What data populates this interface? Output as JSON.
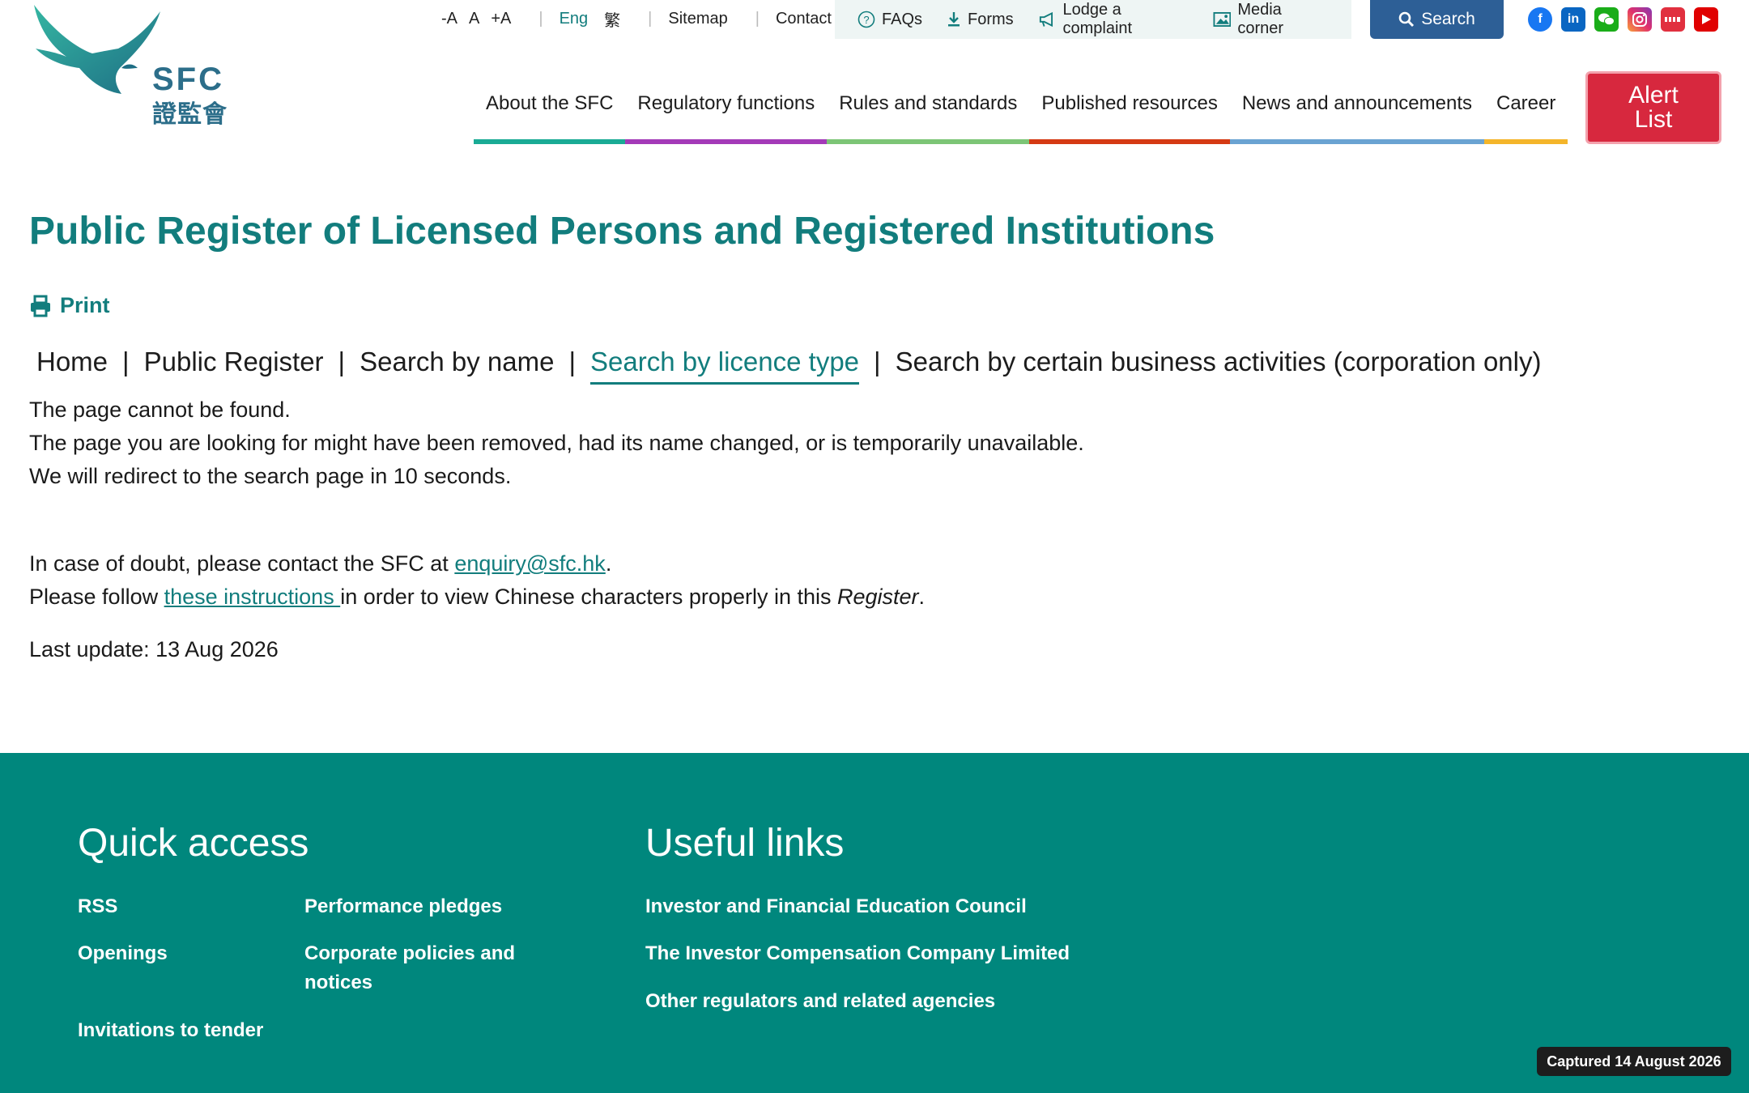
{
  "brand": {
    "name": "SFC",
    "name_cn": "證監會",
    "color": "#2c6e8a",
    "accent": "#127d7d"
  },
  "utility": {
    "font_small": "-A",
    "font_normal": "A",
    "font_large": "+A",
    "lang_en": "Eng",
    "lang_tc": "繁",
    "sitemap": "Sitemap",
    "contact": "Contact us",
    "faqs": "FAQs",
    "forms": "Forms",
    "complaint": "Lodge a complaint",
    "media": "Media corner",
    "search": "Search"
  },
  "socials": [
    "facebook-icon",
    "linkedin-icon",
    "wechat-icon",
    "instagram-icon",
    "xiaohongshu-icon",
    "youtube-icon"
  ],
  "nav": {
    "items": [
      {
        "label": "About the SFC",
        "color": "#1aab95"
      },
      {
        "label": "Regulatory functions",
        "color": "#a43ab8"
      },
      {
        "label": "Rules and standards",
        "color": "#7cc576"
      },
      {
        "label": "Published resources",
        "color": "#d53a14"
      },
      {
        "label": "News and announcements",
        "color": "#6aa3d2"
      },
      {
        "label": "Career",
        "color": "#f4b52a"
      }
    ],
    "alert_line1": "Alert",
    "alert_line2": "List"
  },
  "page": {
    "title": "Public Register of Licensed Persons and Registered Institutions",
    "print": "Print",
    "breadcrumbs": [
      "Home",
      "Public Register",
      "Search by name",
      "Search by licence type",
      "Search by certain business activities (corporation only)"
    ],
    "crumb_sep": "|",
    "msg1": "The page cannot be found.",
    "msg2": "The page you are looking for might have been removed, had its name changed, or is temporarily unavailable.",
    "msg3": "We will redirect to the search page in 10 seconds.",
    "doubt_pre": "In case of doubt, please contact the SFC at ",
    "doubt_email": "enquiry@sfc.hk",
    "doubt_post": ".",
    "follow_pre": "Please follow ",
    "follow_link": "these instructions ",
    "follow_mid": "in order to view Chinese characters properly in this ",
    "follow_italic": "Register",
    "follow_post": ".",
    "last_update": "Last update: 13 Aug 2026"
  },
  "footer": {
    "quick_title": "Quick access",
    "quick": [
      "RSS",
      "Performance pledges",
      "Openings",
      "Corporate policies and",
      "notices",
      "Invitations to tender"
    ],
    "useful_title": "Useful links",
    "useful": [
      "Investor and Financial Education Council",
      "The Investor Compensation Company Limited",
      "Other regulators and related agencies"
    ],
    "bg": "#00877d"
  },
  "captured": "Captured 14 August 2026"
}
